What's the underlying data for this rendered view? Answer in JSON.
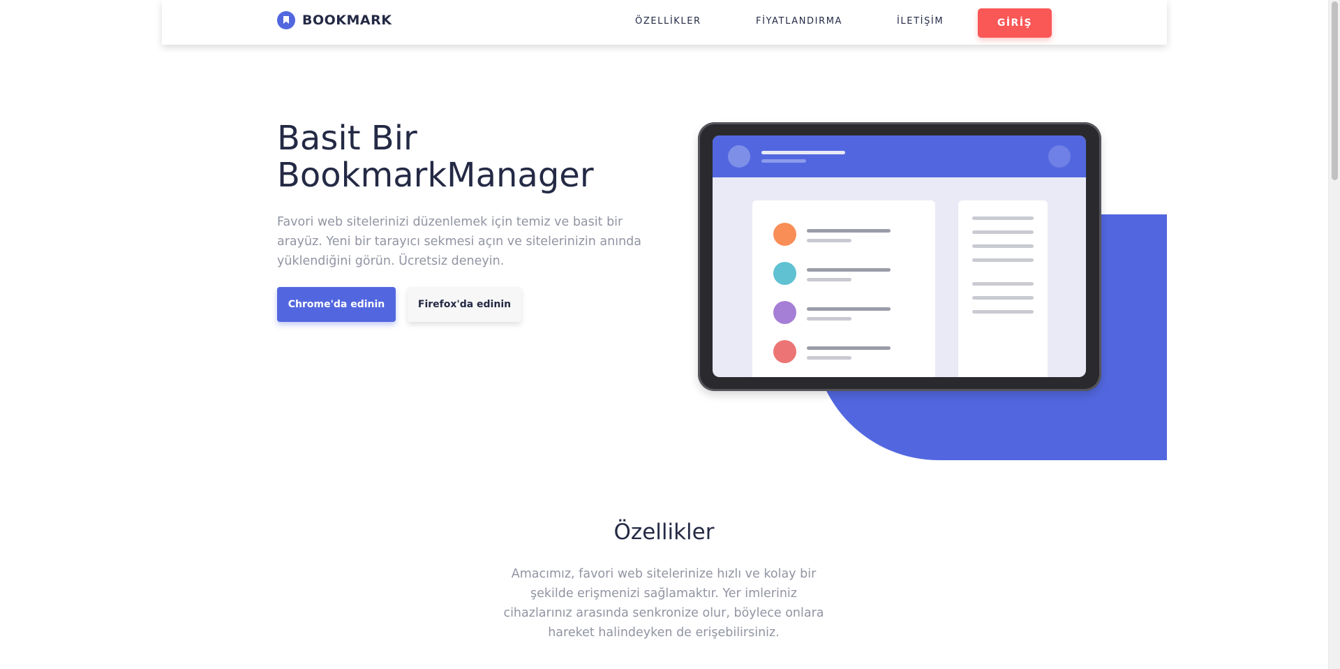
{
  "header": {
    "logo_text": "BOOKMARK",
    "nav": [
      "ÖZELLİKLER",
      "FİYATLANDIRMA",
      "İLETİŞİM"
    ],
    "login_label": "GİRİŞ"
  },
  "hero": {
    "title_line1": "Basit Bir",
    "title_line2": "BookmarkManager",
    "description": "Favori web sitelerinizi düzenlemek için temiz ve basit bir arayüz. Yeni bir tarayıcı sekmesi açın ve sitelerinizin anında yüklendiğini görün. Ücretsiz deneyin.",
    "chrome_button": "Chrome'da edinin",
    "firefox_button": "Firefox'da edinin"
  },
  "illustration": {
    "item_colors": [
      "#f98e57",
      "#5fc1d2",
      "#a57ed6",
      "#ec7474"
    ]
  },
  "features": {
    "title": "Özellikler",
    "description": "Amacımız, favori web sitelerinize hızlı ve kolay bir şekilde erişmenizi sağlamaktır. Yer imleriniz cihazlarınız arasında senkronize olur, böylece onlara hareket halindeyken de erişebilirsiniz."
  },
  "colors": {
    "accent": "#5267df",
    "login": "#fa5757",
    "text_dark": "#242a45",
    "text_gray": "#9194a2"
  }
}
